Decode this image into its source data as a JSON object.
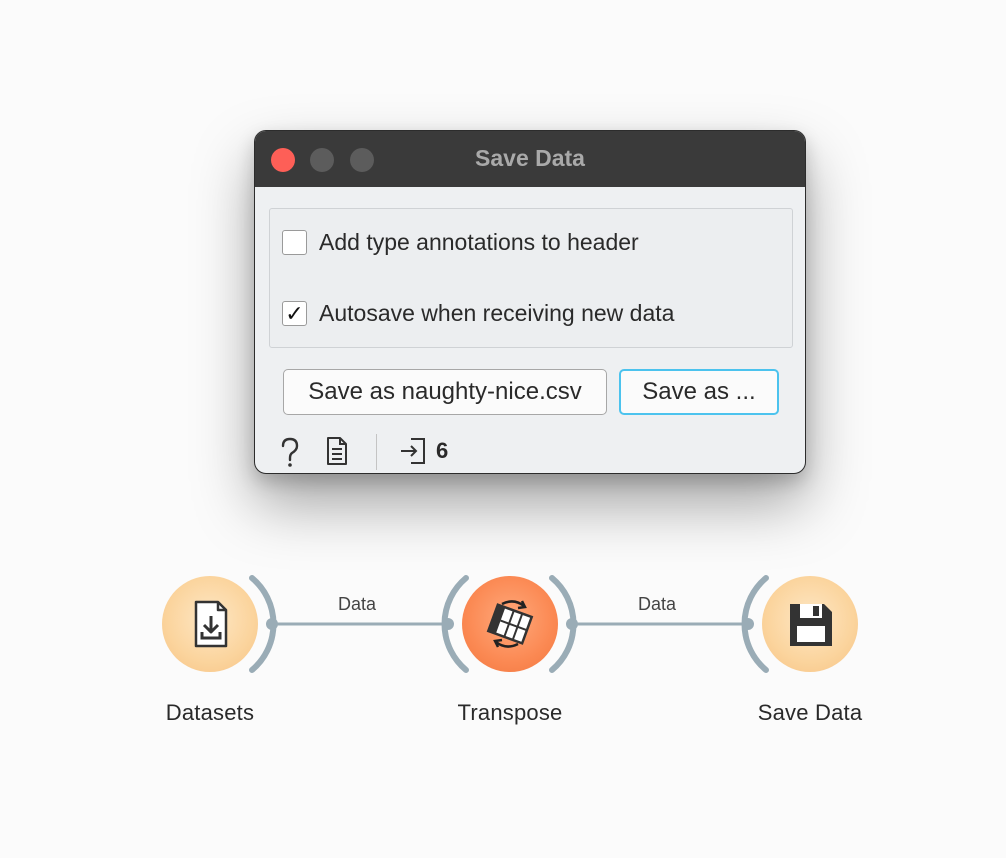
{
  "window": {
    "title": "Save Data",
    "options": {
      "add_annotations": {
        "label": "Add type annotations to header",
        "checked": false
      },
      "autosave": {
        "label": "Autosave when receiving new data",
        "checked": true,
        "mark": "✓"
      }
    },
    "buttons": {
      "save_file": "Save as naughty-nice.csv",
      "save_as": "Save as ..."
    },
    "status_bar": {
      "icons": [
        "help-icon",
        "report-icon",
        "input-icon"
      ],
      "input_count": "6"
    }
  },
  "workflow": {
    "nodes": [
      {
        "name": "Datasets",
        "icon": "download-file-icon"
      },
      {
        "name": "Transpose",
        "icon": "transpose-table-icon"
      },
      {
        "name": "Save Data",
        "icon": "floppy-disk-icon"
      }
    ],
    "links": [
      {
        "label": "Data"
      },
      {
        "label": "Data"
      }
    ]
  },
  "colors": {
    "link": "#9aacb6",
    "accent_focus": "#4cc3ee",
    "close_button": "#fe5f57",
    "node_light": "#fbd49d",
    "node_orange": "#fb8953"
  }
}
